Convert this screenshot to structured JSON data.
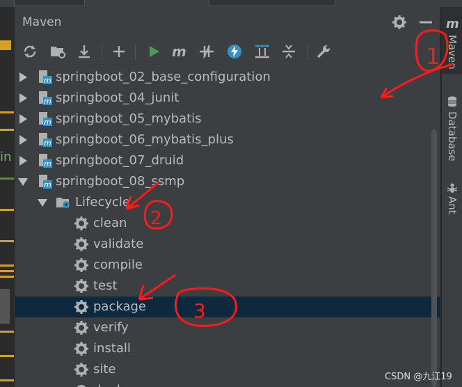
{
  "panel": {
    "title": "Maven"
  },
  "toolbar": {
    "icons": [
      "reload-icon",
      "generate-sources-icon",
      "download-icon",
      "add-icon",
      "run-icon",
      "maven-goal-icon",
      "toggle-offline-icon",
      "skip-tests-icon",
      "show-dependencies-icon",
      "collapse-all-icon",
      "settings-wrench-icon"
    ]
  },
  "tree": {
    "projects": [
      "springboot_02_base_configuration",
      "springboot_04_junit",
      "springboot_05_mybatis",
      "springboot_06_mybatis_plus",
      "springboot_07_druid",
      "springboot_08_ssmp"
    ],
    "lifecycle_label": "Lifecycle",
    "goals": [
      "clean",
      "validate",
      "compile",
      "test",
      "package",
      "verify",
      "install",
      "site",
      "deploy"
    ],
    "selected_goal": "package"
  },
  "right_strip": {
    "tabs": [
      "Maven",
      "Database",
      "Ant"
    ]
  },
  "annotations": [
    "1",
    "2",
    "3"
  ],
  "watermark": "CSDN @九江19",
  "colors": {
    "panel_bg": "#3c3f41",
    "selection": "#0d293e",
    "run_green": "#499c54",
    "maven_blue": "#3592c4",
    "annotation_red": "#ff1a1a"
  }
}
